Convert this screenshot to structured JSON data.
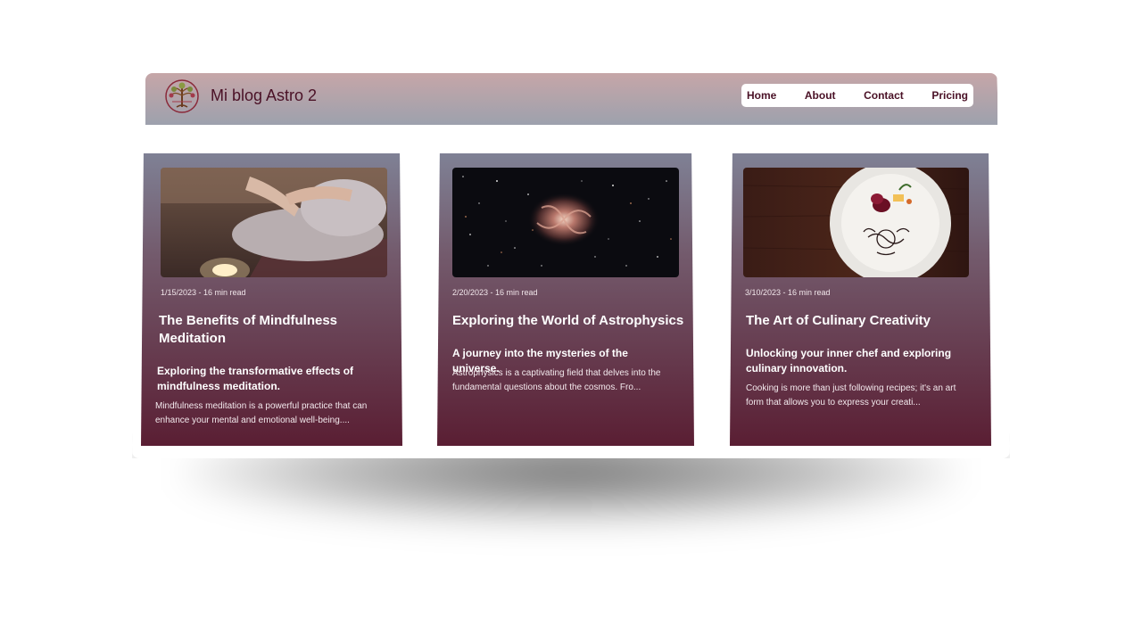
{
  "site": {
    "title": "Mi blog Astro 2",
    "logo_icon": "tree-logo-icon"
  },
  "nav": {
    "items": [
      {
        "label": "Home"
      },
      {
        "label": "About"
      },
      {
        "label": "Contact"
      },
      {
        "label": "Pricing"
      }
    ]
  },
  "posts": [
    {
      "meta": "1/15/2023 - 16 min read",
      "title": "The Benefits of Mindfulness Meditation",
      "subtitle": "Exploring the transformative effects of mindfulness meditation.",
      "excerpt": "Mindfulness meditation is a powerful practice that can enhance your mental and emotional well-being....",
      "image_icon": "meditation-image"
    },
    {
      "meta": "2/20/2023 - 16 min read",
      "title": "Exploring the World of Astrophysics",
      "subtitle": "A journey into the mysteries of the universe.",
      "excerpt": "Astrophysics is a captivating field that delves into the fundamental questions about the cosmos. Fro...",
      "image_icon": "galaxy-image"
    },
    {
      "meta": "3/10/2023 - 16 min read",
      "title": "The Art of Culinary Creativity",
      "subtitle": "Unlocking your inner chef and exploring culinary innovation.",
      "excerpt": "Cooking is more than just following recipes; it's an art form that allows you to express your creati...",
      "image_icon": "dessert-plate-image"
    }
  ],
  "colors": {
    "brand": "#4a1126",
    "header_top": "#c6a6a8",
    "header_bottom": "#9da1ad",
    "card_top": "#7f8195",
    "card_bottom": "#5a1e33"
  }
}
